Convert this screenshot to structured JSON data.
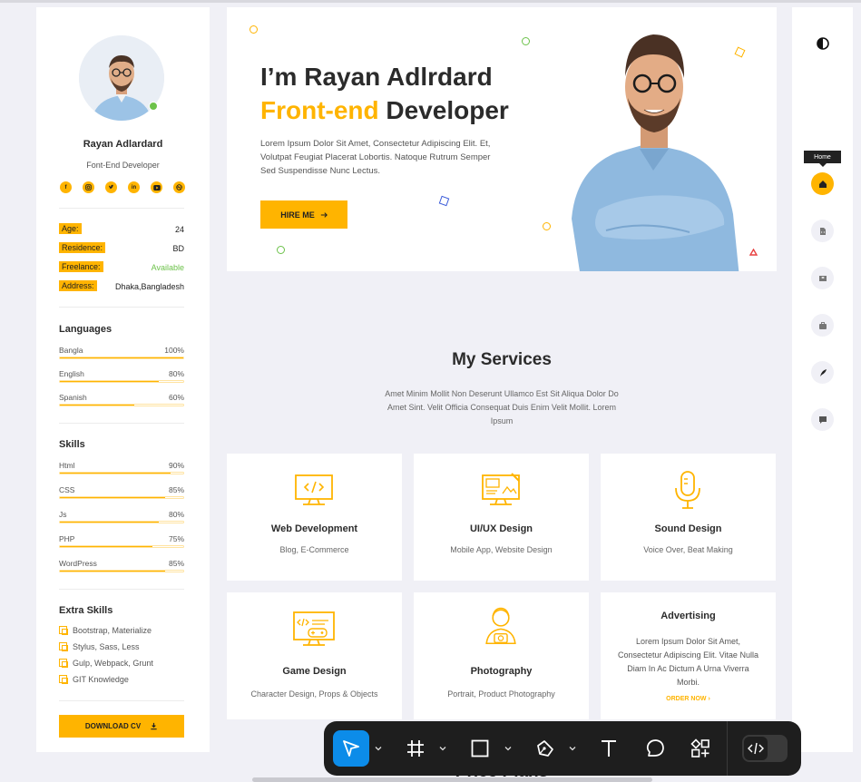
{
  "profile": {
    "name": "Rayan Adlardard",
    "role": "Font-End Developer",
    "socials": [
      "facebook-icon",
      "instagram-icon",
      "twitter-icon",
      "linkedin-icon",
      "youtube-icon",
      "dribbble-icon"
    ],
    "info": [
      {
        "key": "Age:",
        "value": "24"
      },
      {
        "key": "Residence:",
        "value": "BD"
      },
      {
        "key": "Freelance:",
        "value": "Available"
      },
      {
        "key": "Address:",
        "value": "Dhaka,Bangladesh"
      }
    ]
  },
  "languages": {
    "title": "Languages",
    "items": [
      {
        "label": "Bangla",
        "percent": "100%",
        "value": 100
      },
      {
        "label": "English",
        "percent": "80%",
        "value": 80
      },
      {
        "label": "Spanish",
        "percent": "60%",
        "value": 60
      }
    ]
  },
  "skills": {
    "title": "Skills",
    "items": [
      {
        "label": "Html",
        "percent": "90%",
        "value": 90
      },
      {
        "label": "CSS",
        "percent": "85%",
        "value": 85
      },
      {
        "label": "Js",
        "percent": "80%",
        "value": 80
      },
      {
        "label": "PHP",
        "percent": "75%",
        "value": 75
      },
      {
        "label": "WordPress",
        "percent": "85%",
        "value": 85
      }
    ]
  },
  "extra_skills": {
    "title": "Extra Skills",
    "items": [
      "Bootstrap, Materialize",
      "Stylus, Sass, Less",
      "Gulp, Webpack, Grunt",
      "GIT Knowledge"
    ]
  },
  "download_cv": "DOWNLOAD CV",
  "hero": {
    "line1": "I’m Rayan Adlrdard",
    "accent": "Front-end",
    "line2_rest": " Developer",
    "description": "Lorem Ipsum Dolor Sit Amet, Consectetur Adipiscing Elit. Et, Volutpat Feugiat Placerat Lobortis. Natoque Rutrum Semper Sed Suspendisse Nunc Lectus.",
    "button": "HIRE ME"
  },
  "services": {
    "title": "My Services",
    "description": "Amet Minim Mollit Non Deserunt Ullamco Est Sit Aliqua Dolor Do Amet Sint. Velit Officia Consequat Duis Enim Velit Mollit. Lorem Ipsum",
    "cards": [
      {
        "icon": "monitor-code-icon",
        "title": "Web Development",
        "subtitle": "Blog, E-Commerce"
      },
      {
        "icon": "design-screen-icon",
        "title": "UI/UX Design",
        "subtitle": "Mobile App, Website Design"
      },
      {
        "icon": "microphone-icon",
        "title": "Sound Design",
        "subtitle": "Voice Over, Beat Making"
      },
      {
        "icon": "game-monitor-icon",
        "title": "Game Design",
        "subtitle": "Character Design, Props & Objects"
      },
      {
        "icon": "photographer-icon",
        "title": "Photography",
        "subtitle": "Portrait, Product Photography"
      }
    ],
    "advertising": {
      "title": "Advertising",
      "body": "Lorem Ipsum Dolor Sit Amet, Consectetur Adipiscing Elit. Vitae Nulla Diam In Ac Dictum A Urna Viverra Morbi.",
      "link": "ORDER NOW"
    }
  },
  "nav": {
    "tooltip": "Home",
    "items": [
      "home-icon",
      "resume-icon",
      "education-icon",
      "portfolio-icon",
      "blog-icon",
      "contact-icon"
    ]
  },
  "price_title": "Price Plans",
  "colors": {
    "accent": "#ffb400",
    "available": "#6cc24a",
    "toolbar": "#1e1e1e",
    "toolbar_selected": "#0c8ce9"
  }
}
